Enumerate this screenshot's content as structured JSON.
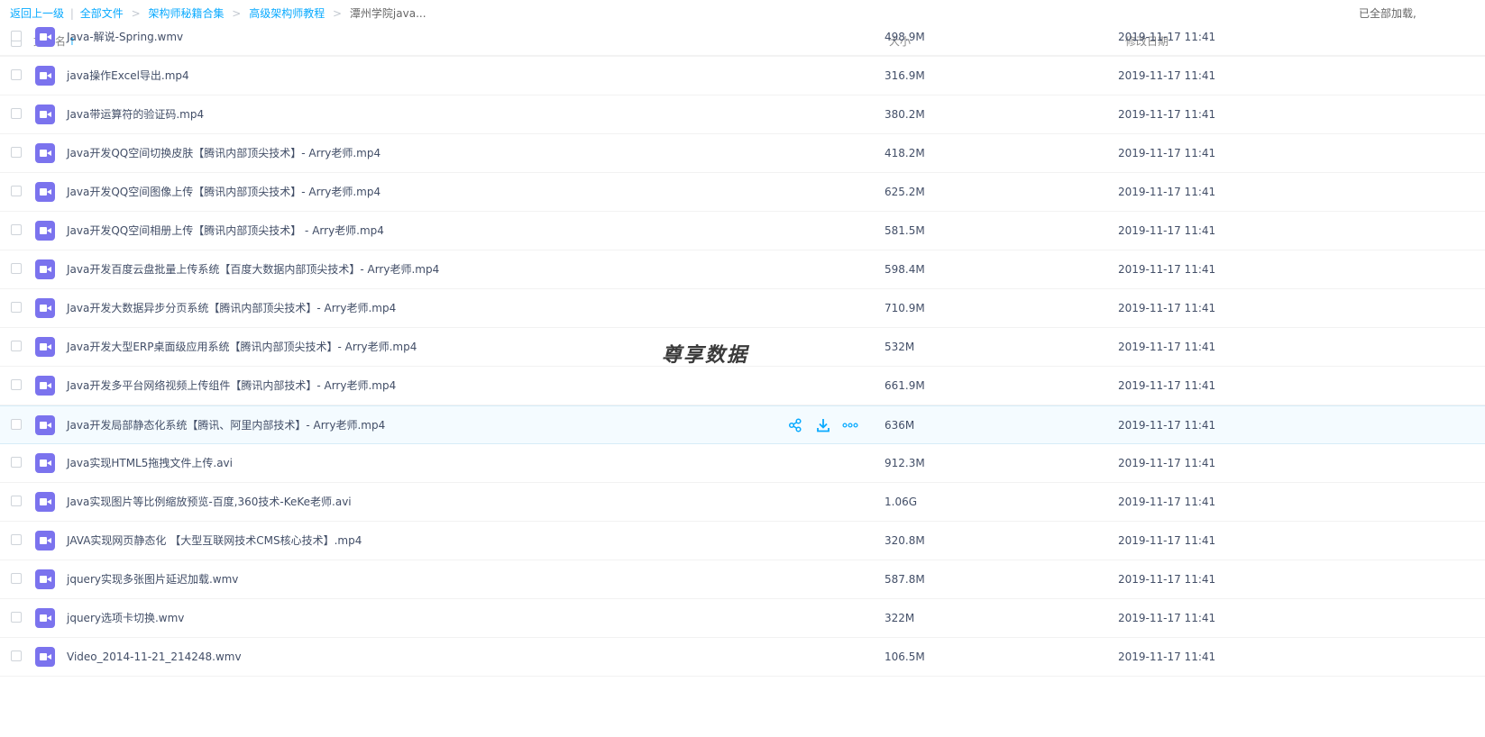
{
  "breadcrumb": {
    "back": "返回上一级",
    "divider": "|",
    "all_files": "全部文件",
    "level1": "架构师秘籍合集",
    "level2": "高级架构师教程",
    "current": "潭州学院java...",
    "separator": ">",
    "status": "已全部加载,"
  },
  "table": {
    "col_name": "文件名",
    "col_size": "大小",
    "col_date": "修改日期",
    "sort_icon": "arrow-up-icon"
  },
  "files": [
    {
      "name": "Java-解说-Spring.wmv",
      "size": "498.9M",
      "date": "2019-11-17 11:41"
    },
    {
      "name": "java操作Excel导出.mp4",
      "size": "316.9M",
      "date": "2019-11-17 11:41"
    },
    {
      "name": "Java带运算符的验证码.mp4",
      "size": "380.2M",
      "date": "2019-11-17 11:41"
    },
    {
      "name": "Java开发QQ空间切换皮肤【腾讯内部顶尖技术】- Arry老师.mp4",
      "size": "418.2M",
      "date": "2019-11-17 11:41"
    },
    {
      "name": "Java开发QQ空间图像上传【腾讯内部顶尖技术】- Arry老师.mp4",
      "size": "625.2M",
      "date": "2019-11-17 11:41"
    },
    {
      "name": "Java开发QQ空间相册上传【腾讯内部顶尖技术】 - Arry老师.mp4",
      "size": "581.5M",
      "date": "2019-11-17 11:41"
    },
    {
      "name": "Java开发百度云盘批量上传系统【百度大数据内部顶尖技术】- Arry老师.mp4",
      "size": "598.4M",
      "date": "2019-11-17 11:41"
    },
    {
      "name": "Java开发大数据异步分页系统【腾讯内部顶尖技术】- Arry老师.mp4",
      "size": "710.9M",
      "date": "2019-11-17 11:41"
    },
    {
      "name": "Java开发大型ERP桌面级应用系统【腾讯内部顶尖技术】- Arry老师.mp4",
      "size": "532M",
      "date": "2019-11-17 11:41"
    },
    {
      "name": "Java开发多平台网络视频上传组件【腾讯内部技术】- Arry老师.mp4",
      "size": "661.9M",
      "date": "2019-11-17 11:41"
    },
    {
      "name": "Java开发局部静态化系统【腾讯、阿里内部技术】- Arry老师.mp4",
      "size": "636M",
      "date": "2019-11-17 11:41"
    },
    {
      "name": "Java实现HTML5拖拽文件上传.avi",
      "size": "912.3M",
      "date": "2019-11-17 11:41"
    },
    {
      "name": "Java实现图片等比例缩放预览-百度,360技术-KeKe老师.avi",
      "size": "1.06G",
      "date": "2019-11-17 11:41"
    },
    {
      "name": "JAVA实现网页静态化 【大型互联网技术CMS核心技术】.mp4",
      "size": "320.8M",
      "date": "2019-11-17 11:41"
    },
    {
      "name": "jquery实现多张图片延迟加载.wmv",
      "size": "587.8M",
      "date": "2019-11-17 11:41"
    },
    {
      "name": "jquery选项卡切换.wmv",
      "size": "322M",
      "date": "2019-11-17 11:41"
    },
    {
      "name": "Video_2014-11-21_214248.wmv",
      "size": "106.5M",
      "date": "2019-11-17 11:41"
    }
  ],
  "hover_actions": {
    "share_icon": "share-icon",
    "download_icon": "download-icon",
    "more_icon": "more-icon"
  },
  "watermark": "尊享数据",
  "colors": {
    "link": "#09aaff",
    "file_icon": "#7b73ee",
    "hover_row": "#f4fbff"
  }
}
